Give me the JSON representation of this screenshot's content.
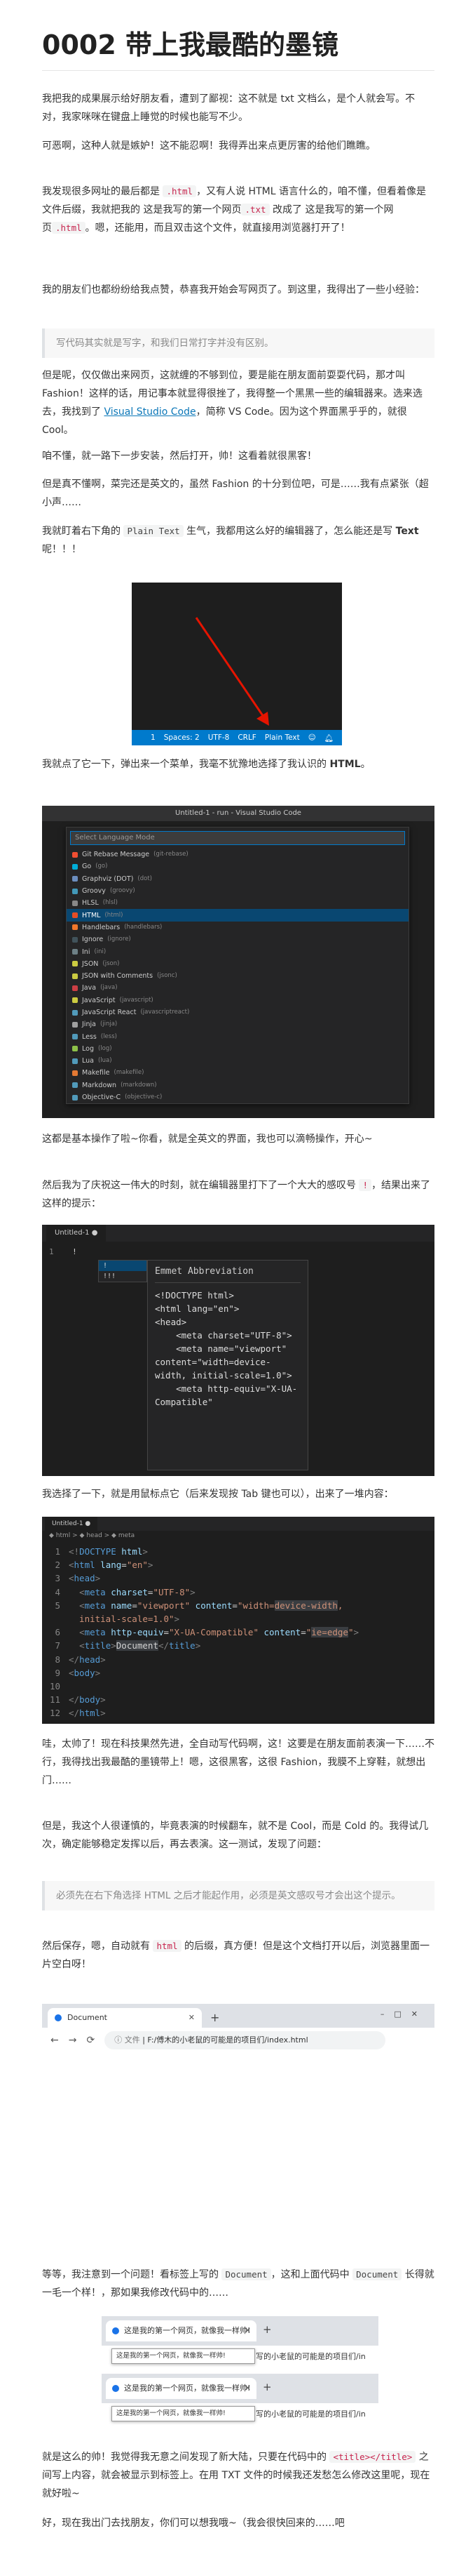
{
  "title": "0002 带上我最酷的墨镜",
  "p1": "我把我的成果展示给好朋友看，遭到了鄙视：这不就是 txt 文档么，是个人就会写。不对，我家咪咪在键盘上睡觉的时候也能写不少。",
  "p2": "可恶啊，这种人就是嫉妒！这不能忍啊！我得弄出来点更厉害的给他们瞧瞧。",
  "p3": {
    "a": "我发现很多网址的最后都是 ",
    "code1": ".html",
    "b": "，又有人说 HTML 语言什么的，咱不懂，但看着像是文件后缀，我就把我的 这是我写的第一个网页",
    "code2": ".txt",
    "c": " 改成了 这是我写的第一个网页",
    "code3": ".html",
    "d": "。嗯，还能用，而且双击这个文件，就直接用浏览器打开了！"
  },
  "p4": "我的朋友们也都纷纷给我点赞，恭喜我开始会写网页了。到这里，我得出了一些小经验：",
  "quote1": "写代码其实就是写字，和我们日常打字并没有区别。",
  "p5": {
    "a": "但是呢，仅仅做出来网页，这就缠的不够到位，要是能在朋友面前耍耍代码，那才叫 Fashion！这样的话，用记事本就显得很挫了，我得整一个黑黑一些的编辑器来。选来选去，我找到了 ",
    "link": "Visual Studio Code",
    "b": "，简称 VS Code。因为这个界面黑乎乎的，就很 Cool。"
  },
  "p6": "咱不懂，就一路下一步安装，然后打开，帅！这看着就很黑客！",
  "p7": "但是真不懂啊，菜完还是英文的，虽然 Fashion 的十分到位吧，可是……我有点紧张（超小声……",
  "p8": {
    "a": "我就盯着右下角的 ",
    "code": "Plain Text",
    "b": " 生气，我都用这么好的编辑器了，怎么能还是写 ",
    "bold": "Text",
    "c": " 呢！！！"
  },
  "shot1": {
    "status_items": [
      "1",
      "Spaces: 2",
      "UTF-8",
      "CRLF",
      "Plain Text"
    ],
    "accent": "#007acc",
    "arrow_color": "#e51400"
  },
  "p9": {
    "a": "我就点了它一下，弹出来一个菜单，我毫不犹豫地选择了我认识的 ",
    "bold": "HTML",
    "b": "。"
  },
  "shot2": {
    "window_title": "Untitled-1 - run - Visual Studio Code",
    "input_placeholder": "Select Language Mode",
    "languages": [
      {
        "name": "Git Rebase Message",
        "id": "(git-rebase)",
        "color": "#f14e32"
      },
      {
        "name": "Go",
        "id": "(go)",
        "color": "#00add8"
      },
      {
        "name": "Graphviz (DOT)",
        "id": "(dot)",
        "color": "#6c8ebf"
      },
      {
        "name": "Groovy",
        "id": "(groovy)",
        "color": "#4298b8"
      },
      {
        "name": "HLSL",
        "id": "(hlsl)",
        "color": "#888888"
      },
      {
        "name": "HTML",
        "id": "(html)",
        "color": "#e44d26"
      },
      {
        "name": "Handlebars",
        "id": "(handlebars)",
        "color": "#f0772b"
      },
      {
        "name": "Ignore",
        "id": "(ignore)",
        "color": "#41535b"
      },
      {
        "name": "Ini",
        "id": "(ini)",
        "color": "#6d8086"
      },
      {
        "name": "JSON",
        "id": "(json)",
        "color": "#cbcb41"
      },
      {
        "name": "JSON with Comments",
        "id": "(jsonc)",
        "color": "#cbcb41"
      },
      {
        "name": "Java",
        "id": "(java)",
        "color": "#cc3e44"
      },
      {
        "name": "JavaScript",
        "id": "(javascript)",
        "color": "#cbcb41"
      },
      {
        "name": "JavaScript React",
        "id": "(javascriptreact)",
        "color": "#519aba"
      },
      {
        "name": "Jinja",
        "id": "(jinja)",
        "color": "#a0a0a0"
      },
      {
        "name": "Less",
        "id": "(less)",
        "color": "#519aba"
      },
      {
        "name": "Log",
        "id": "(log)",
        "color": "#8dc149"
      },
      {
        "name": "Lua",
        "id": "(lua)",
        "color": "#519aba"
      },
      {
        "name": "Makefile",
        "id": "(makefile)",
        "color": "#e37933"
      },
      {
        "name": "Markdown",
        "id": "(markdown)",
        "color": "#519aba"
      },
      {
        "name": "Objective-C",
        "id": "(objective-c)",
        "color": "#519aba"
      }
    ],
    "selected_index": 5
  },
  "p10": "这都是基本操作了啦~你看，就是全英文的界面，我也可以滴畅操作，开心~",
  "p11": {
    "a": "然后我为了庆祝这一伟大的时刻，就在编辑器里打下了一个大大的感叹号 ",
    "code": "!",
    "b": "，结果出来了这样的提示："
  },
  "shot3": {
    "tab": "Untitled-1 ●",
    "gutter": "1",
    "typed": "!",
    "suggestions": [
      "!",
      "!!!"
    ],
    "doc_title": "Emmet Abbreviation",
    "doc_code": "<!DOCTYPE html>\n<html lang=\"en\">\n<head>\n    <meta charset=\"UTF-8\">\n    <meta name=\"viewport\" content=\"width=device-width, initial-scale=1.0\">\n    <meta http-equiv=\"X-UA-Compatible\""
  },
  "p12": "我选择了一下，就是用鼠标点它（后来发现按 Tab 键也可以），出来了一堆内容：",
  "shot4": {
    "tab": "Untitled-1 ●",
    "breadcrumb": "◆ html > ◆ head > ◆ meta",
    "line_numbers": [
      "1",
      "2",
      "3",
      "4",
      "5",
      "",
      "6",
      "7",
      "8",
      "9",
      "10",
      "11",
      "12"
    ]
  },
  "p13": "哇，太帅了！现在科技果然先进，全自动写代码啊，这！这要是在朋友面前表演一下……不行，我得找出我最酷的墨镜带上！嗯，这很黑客，这很 Fashion，我膜不上穿鞋，就想出门……",
  "p14": "但是，我这个人很谨慎的，毕竟表演的时候翻车，就不是 Cool，而是 Cold 的。我得试几次，确定能够稳定发挥以后，再去表演。这一测试，发现了问题：",
  "quote2": "必须先在右下角选择 HTML 之后才能起作用，必须是英文感叹号才会出这个提示。",
  "p15": {
    "a": "然后保存，嗯，自动就有 ",
    "code": "html",
    "b": " 的后缀，真方便！但是这个文档打开以后，浏览器里面一片空白呀！"
  },
  "shot5": {
    "tab_title": "Document",
    "url_prefix": "文件",
    "url": "F:/傅木的小老鼠的可能是的项目们/index.html"
  },
  "p16": {
    "a": "等等，我注意到一个问题！看标签上写的 ",
    "code1": "Document",
    "b": "，这和上面代码中 ",
    "code2": "Document",
    "c": " 长得就一毛一个样！，那如果我修改代码中的……"
  },
  "shot6": {
    "tab_title": "这是我的第一个网页，就像我一样帅!",
    "tooltip": "这是我的第一个网页，就像我一样帅!",
    "url_tail": "写的小老鼠的可能是的项目们/in"
  },
  "p17": {
    "a": "就是这么的帅！我觉得我无意之间发现了新大陆，只要在代码中的 ",
    "code": "<title></title>",
    "b": " 之间写上内容，就会被显示到标签上。在用 TXT 文件的时候我还发愁怎么修改这里呢，现在就好啦~"
  },
  "p18": "好，现在我出门去找朋友，你们可以想我哦~（我会很快回来的……吧"
}
